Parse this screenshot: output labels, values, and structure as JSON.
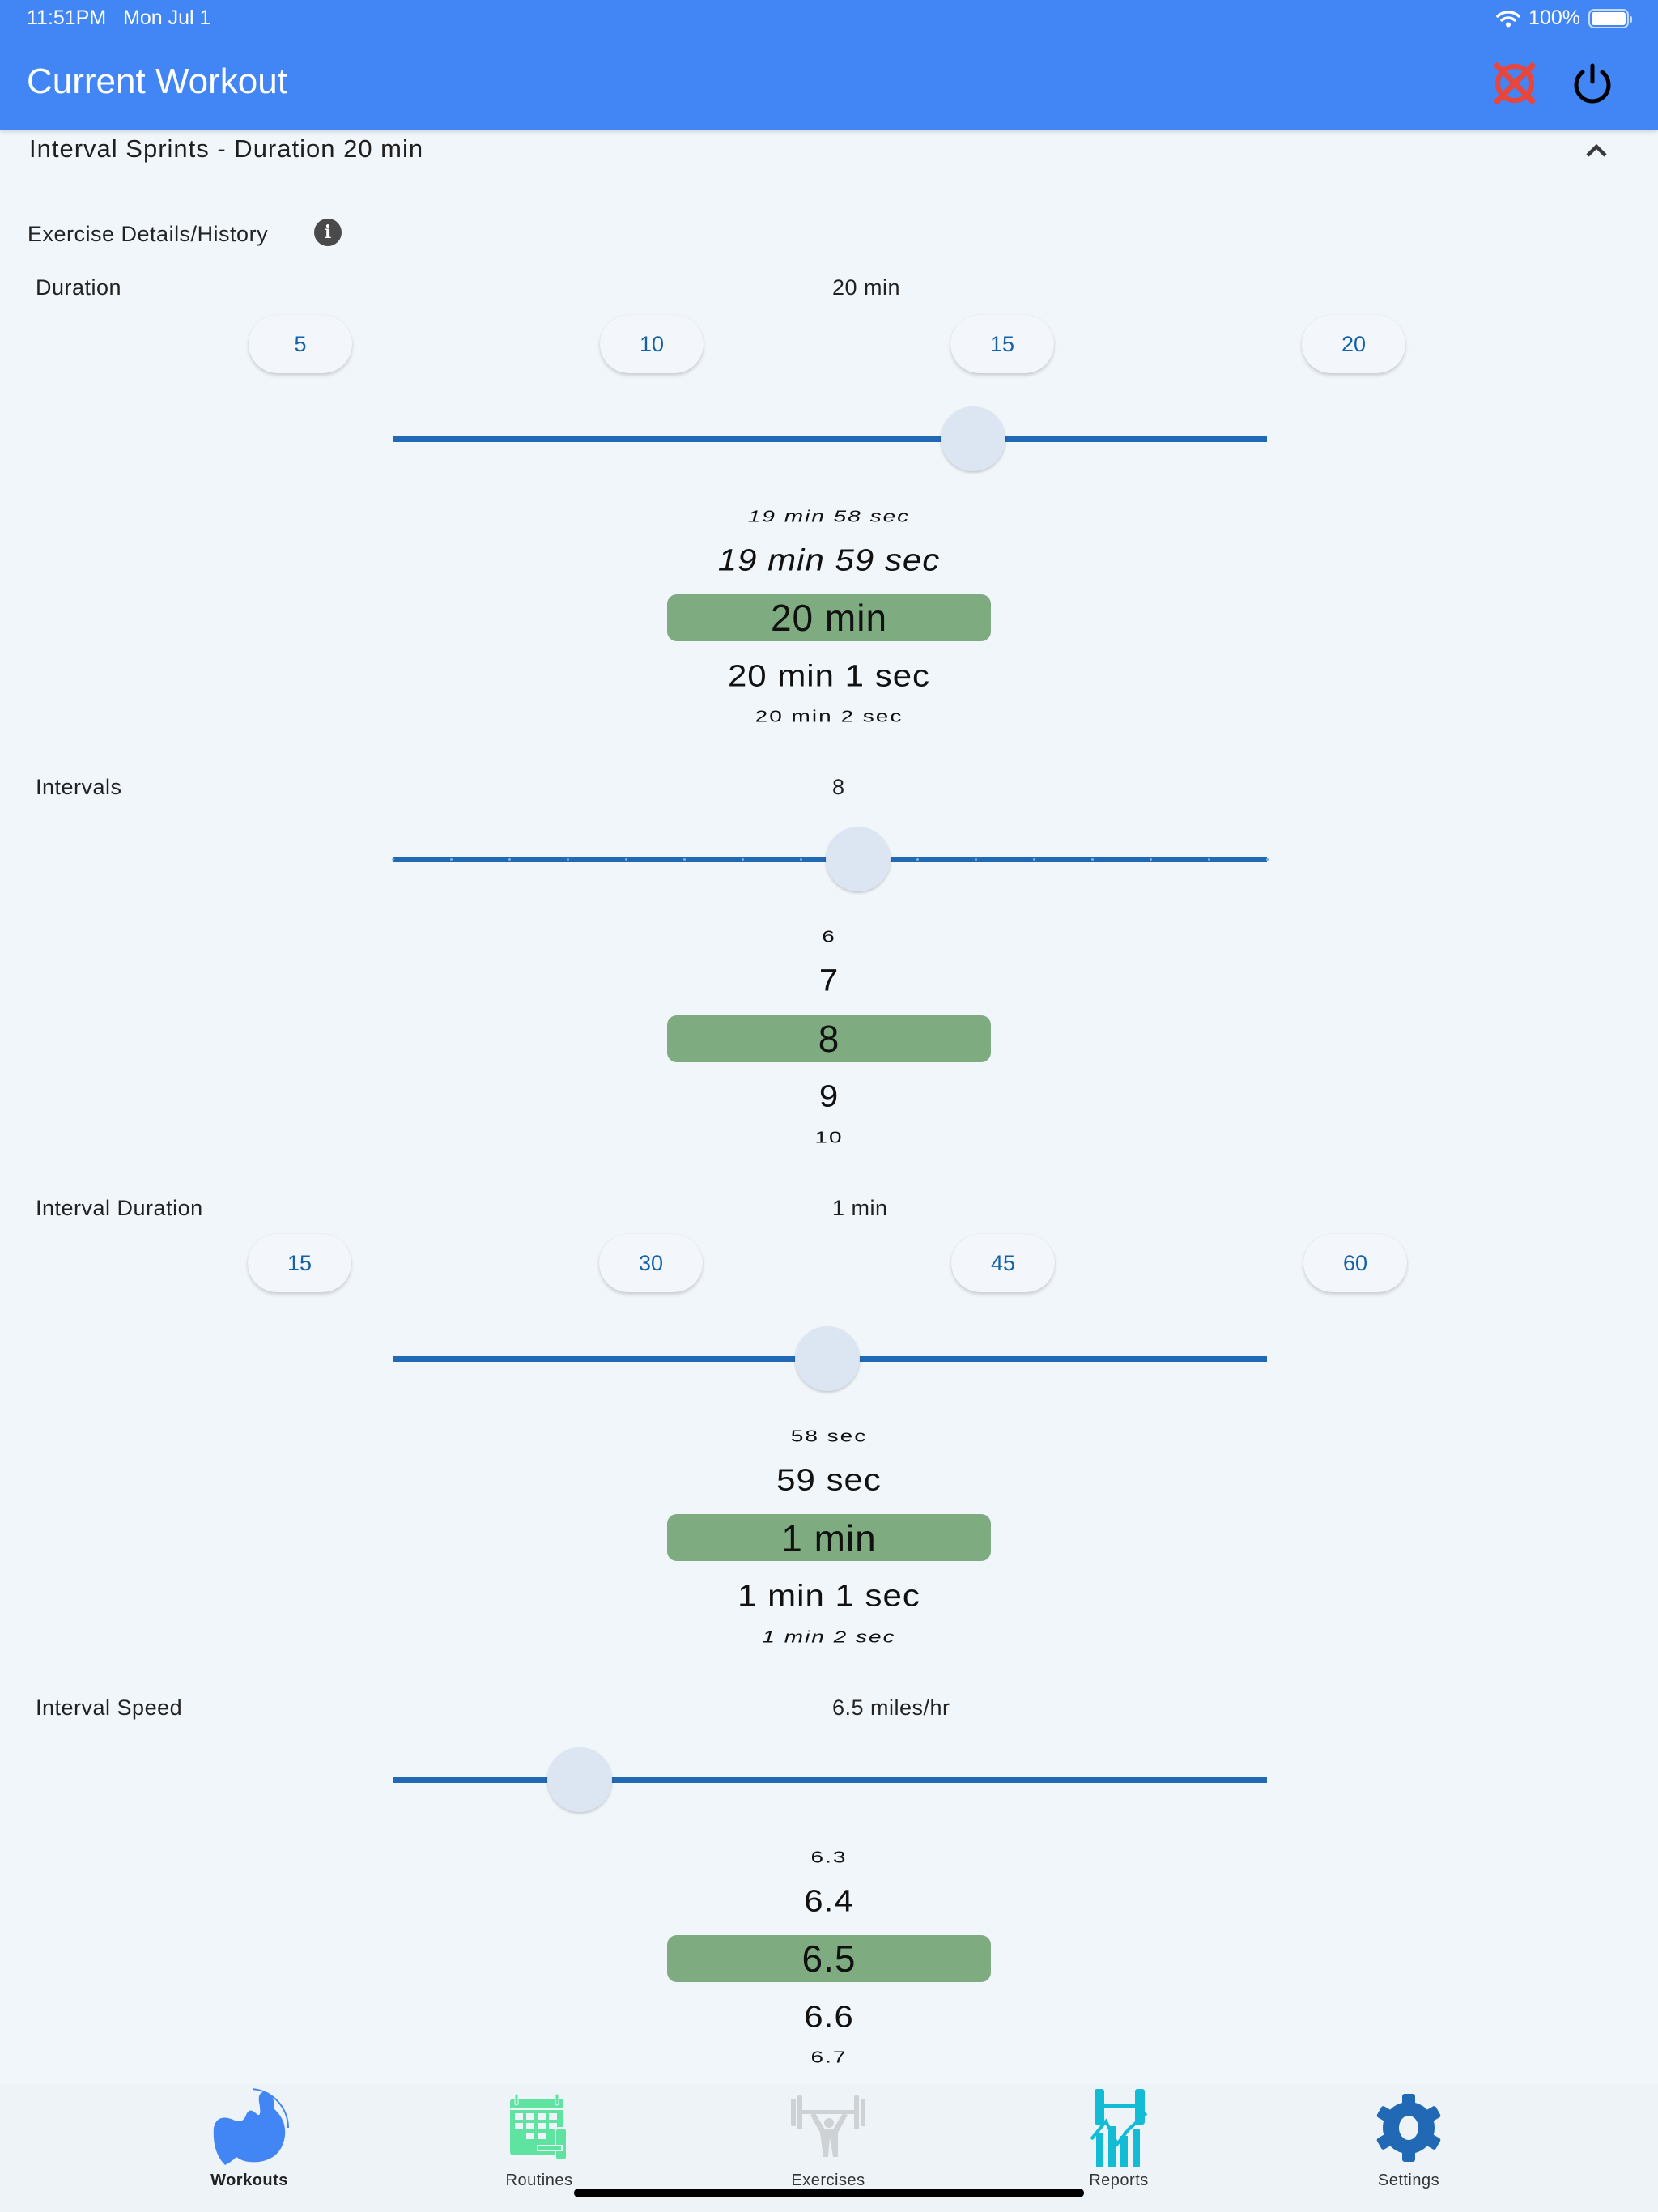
{
  "status_bar": {
    "time": "11:51PM",
    "date": "Mon Jul 1",
    "battery": "100%",
    "wifi_icon": "wifi-icon",
    "battery_icon": "battery-icon"
  },
  "header": {
    "title": "Current Workout",
    "cancel_icon": "cancel-workout-icon",
    "power_icon": "power-icon",
    "colors": {
      "background": "#4285f4",
      "cancel": "#e8453c"
    }
  },
  "workout": {
    "title": "Interval Sprints - Duration 20 min",
    "collapse_icon": "chevron-up-icon"
  },
  "details": {
    "label": "Exercise Details/History",
    "info_icon": "info-icon"
  },
  "fields": {
    "duration": {
      "label": "Duration",
      "value": "20 min",
      "presets": [
        "5",
        "10",
        "15",
        "20"
      ],
      "slider": {
        "value": 20,
        "fraction": 0.664
      },
      "picker": {
        "items": [
          "19 min 58 sec",
          "19 min 59 sec",
          "20 min",
          "20 min 1 sec",
          "20 min 2 sec"
        ],
        "selected": "20 min"
      }
    },
    "intervals": {
      "label": "Intervals",
      "value": "8",
      "slider": {
        "value": 8,
        "fraction": 0.532,
        "ticks": 16
      },
      "picker": {
        "items": [
          "6",
          "7",
          "8",
          "9",
          "10"
        ],
        "selected": "8"
      }
    },
    "interval_duration": {
      "label": "Interval Duration",
      "value": "1 min",
      "presets": [
        "15",
        "30",
        "45",
        "60"
      ],
      "slider": {
        "value": 60,
        "fraction": 0.497
      },
      "picker": {
        "items": [
          "58 sec",
          "59 sec",
          "1 min",
          "1 min 1 sec",
          "1 min 2 sec"
        ],
        "selected": "1 min"
      }
    },
    "interval_speed": {
      "label": "Interval Speed",
      "value": "6.5 miles/hr",
      "slider": {
        "value": 6.5,
        "fraction": 0.214
      },
      "picker": {
        "items": [
          "6.3",
          "6.4",
          "6.5",
          "6.6",
          "6.7"
        ],
        "selected": "6.5"
      }
    }
  },
  "colors": {
    "accent": "#2169b5",
    "picker_selection": "#7eab80",
    "preset_text": "#1561a8",
    "background": "#f1f6fa"
  },
  "tabs": [
    {
      "label": "Workouts",
      "icon": "workouts-icon",
      "active": true
    },
    {
      "label": "Routines",
      "icon": "routines-icon",
      "active": false
    },
    {
      "label": "Exercises",
      "icon": "exercises-icon",
      "active": false
    },
    {
      "label": "Reports",
      "icon": "reports-icon",
      "active": false
    },
    {
      "label": "Settings",
      "icon": "settings-icon",
      "active": false
    }
  ]
}
